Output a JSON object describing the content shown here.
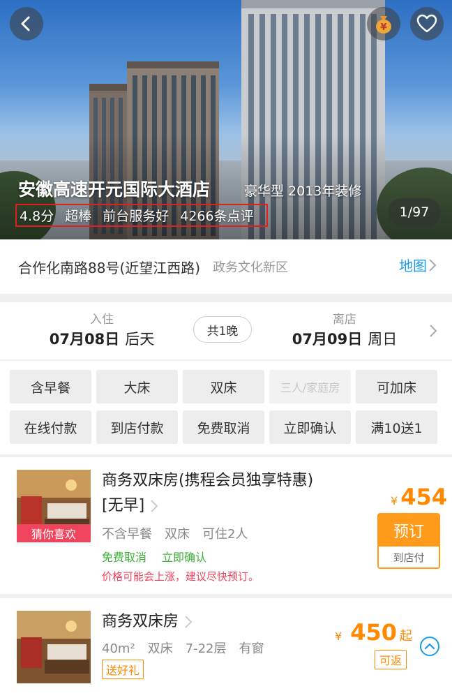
{
  "hero": {
    "title": "安徽高速开元国际大酒店",
    "subtitle": "豪华型 2013年装修",
    "rating": "4.8分",
    "rating_word": "超棒",
    "highlight": "前台服务好",
    "review_count": "4266条点评",
    "photo_counter": "1/97",
    "icons": [
      "back-icon",
      "money-bag-icon",
      "heart-icon"
    ]
  },
  "address": {
    "street": "合作化南路88号(近望江西路)",
    "area": "政务文化新区",
    "map_label": "地图"
  },
  "dates": {
    "checkin_label": "入住",
    "checkin_date": "07月08日",
    "checkin_day": "后天",
    "nights": "共1晚",
    "checkout_label": "离店",
    "checkout_date": "07月09日",
    "checkout_day": "周日"
  },
  "filters": [
    {
      "label": "含早餐",
      "enabled": true
    },
    {
      "label": "大床",
      "enabled": true
    },
    {
      "label": "双床",
      "enabled": true
    },
    {
      "label": "三人/家庭房",
      "enabled": false
    },
    {
      "label": "可加床",
      "enabled": true
    },
    {
      "label": "在线付款",
      "enabled": true
    },
    {
      "label": "到店付款",
      "enabled": true
    },
    {
      "label": "免费取消",
      "enabled": true
    },
    {
      "label": "立即确认",
      "enabled": true
    },
    {
      "label": "满10送1",
      "enabled": true
    }
  ],
  "rooms": [
    {
      "name_line1": "商务双床房(携程会员独享特惠)",
      "name_line2": "[无早]",
      "tag": "猜你喜欢",
      "meta": [
        "不含早餐",
        "双床",
        "可住2人"
      ],
      "perks": [
        "免费取消",
        "立即确认"
      ],
      "warning": "价格可能会上涨，建议尽快预订。",
      "currency": "¥",
      "price": "454",
      "book_label": "预订",
      "pay_label": "到店付"
    },
    {
      "name": "商务双床房",
      "meta": [
        "40m²",
        "双床",
        "7-22层",
        "有窗"
      ],
      "gift": "送好礼",
      "currency": "¥",
      "price": "450",
      "price_suffix": "起",
      "cashback": "可返"
    }
  ],
  "colors": {
    "accent_orange": "#ff8a00",
    "link_blue": "#1b9be8",
    "perk_green": "#3cb034",
    "warning_red": "#f0445e",
    "highlight_border": "#e02020"
  }
}
